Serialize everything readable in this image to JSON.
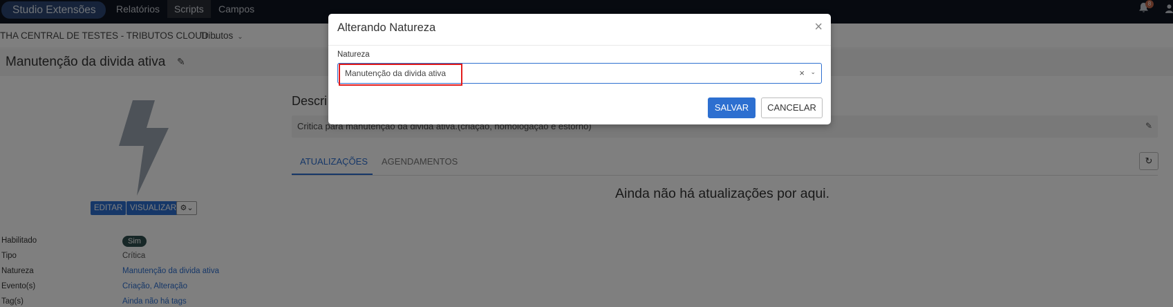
{
  "navbar": {
    "brand": "Studio Extensões",
    "items": [
      {
        "label": "Relatórios",
        "active": false
      },
      {
        "label": "Scripts",
        "active": true
      },
      {
        "label": "Campos",
        "active": false
      }
    ],
    "notifications": "8"
  },
  "breadcrumb": {
    "entity": "THA CENTRAL DE TESTES - TRIBUTOS CLOUD",
    "system": "Tributos"
  },
  "page": {
    "title": "Manutenção da divida ativa"
  },
  "actions": {
    "edit": "EDITAR",
    "view": "VISUALIZAR"
  },
  "properties": [
    {
      "label": "Habilitado",
      "value": "Sim"
    },
    {
      "label": "Tipo",
      "value": "Crítica"
    },
    {
      "label": "Natureza",
      "value": "Manutenção da divida ativa"
    },
    {
      "label": "Evento(s)",
      "value": "Criação, Alteração"
    },
    {
      "label": "Tag(s)",
      "value": "Ainda não há tags"
    }
  ],
  "description": {
    "heading": "Descri",
    "text": "Critica para manutenção da divida ativa.(criação, homologação e estorno)"
  },
  "tabs": [
    {
      "label": "ATUALIZAÇÕES",
      "active": true
    },
    {
      "label": "AGENDAMENTOS",
      "active": false
    }
  ],
  "empty_state": "Ainda não há atualizações por aqui.",
  "modal": {
    "title": "Alterando Natureza",
    "field_label": "Natureza",
    "selected_value": "Manutenção da divida ativa",
    "save_label": "SALVAR",
    "cancel_label": "CANCELAR"
  },
  "colors": {
    "primary": "#2d6fd0",
    "navbar": "#0f1521",
    "highlight": "#e21b1b"
  }
}
